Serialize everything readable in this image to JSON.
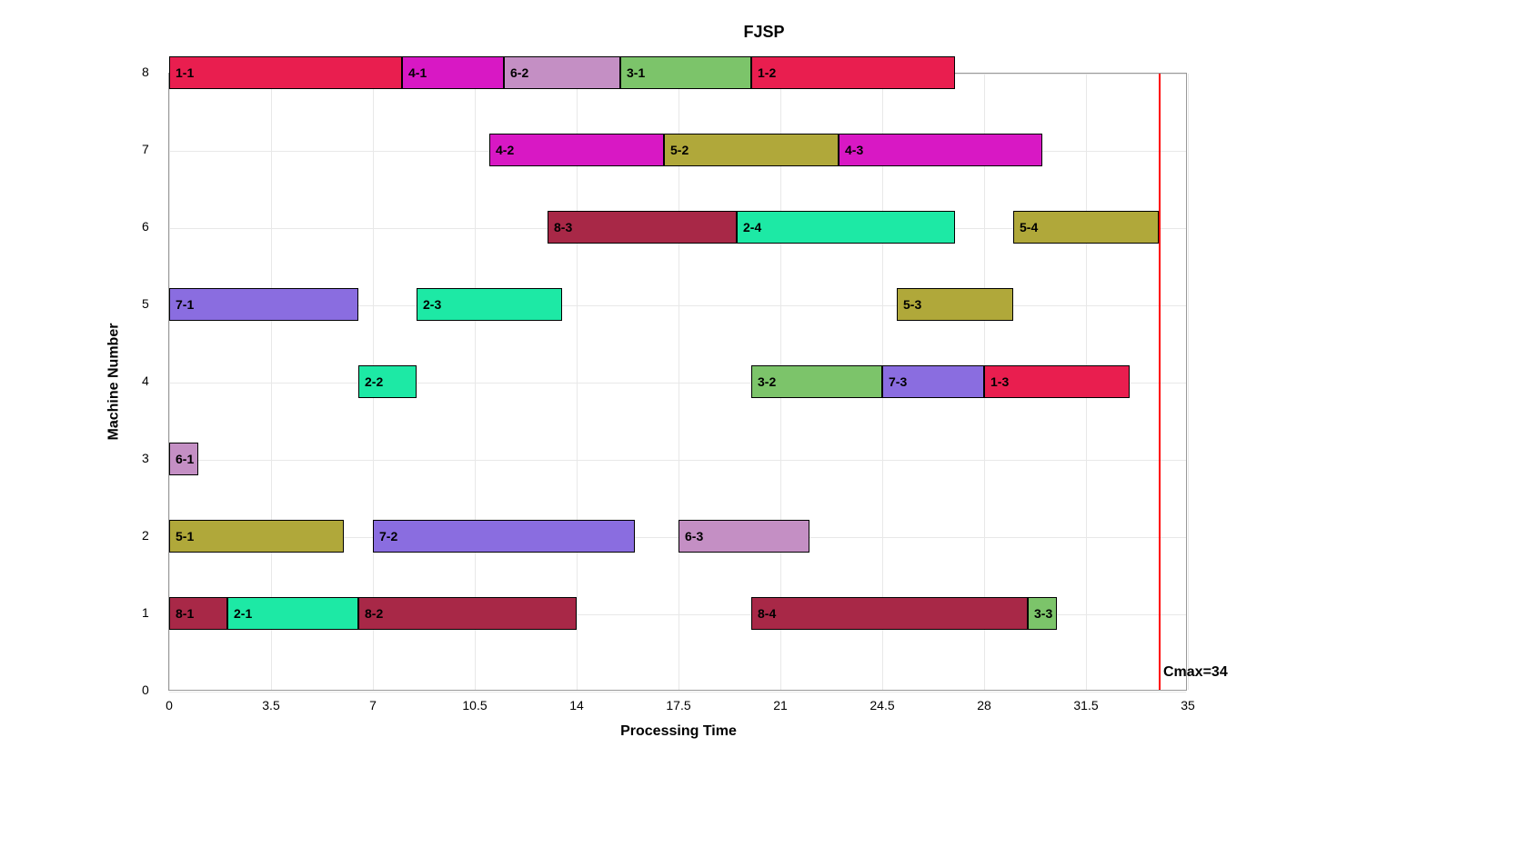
{
  "chart_data": {
    "type": "bar",
    "title": "FJSP",
    "xlabel": "Processing Time",
    "ylabel": "Machine Number",
    "xlim": [
      0,
      35
    ],
    "ylim": [
      0,
      8
    ],
    "xticks": [
      0,
      3.5,
      7,
      10.5,
      14,
      17.5,
      21,
      24.5,
      28,
      31.5,
      35
    ],
    "yticks": [
      0,
      1,
      2,
      3,
      4,
      5,
      6,
      7,
      8
    ],
    "cmax": 34,
    "cmax_label": "Cmax=34",
    "job_colors": {
      "1": "#e91e4f",
      "2": "#1de9a5",
      "3": "#7cc46a",
      "4": "#d818c4",
      "5": "#b0a83a",
      "6": "#c48fc4",
      "7": "#8a6de0",
      "8": "#a82847"
    },
    "bars": [
      {
        "machine": 8,
        "start": 0,
        "end": 8,
        "label": "1-1",
        "job": 1
      },
      {
        "machine": 8,
        "start": 8,
        "end": 11.5,
        "label": "4-1",
        "job": 4
      },
      {
        "machine": 8,
        "start": 11.5,
        "end": 15.5,
        "label": "6-2",
        "job": 6
      },
      {
        "machine": 8,
        "start": 15.5,
        "end": 20,
        "label": "3-1",
        "job": 3
      },
      {
        "machine": 8,
        "start": 20,
        "end": 27,
        "label": "1-2",
        "job": 1
      },
      {
        "machine": 7,
        "start": 11,
        "end": 17,
        "label": "4-2",
        "job": 4
      },
      {
        "machine": 7,
        "start": 17,
        "end": 23,
        "label": "5-2",
        "job": 5
      },
      {
        "machine": 7,
        "start": 23,
        "end": 30,
        "label": "4-3",
        "job": 4
      },
      {
        "machine": 6,
        "start": 13,
        "end": 19.5,
        "label": "8-3",
        "job": 8
      },
      {
        "machine": 6,
        "start": 19.5,
        "end": 27,
        "label": "2-4",
        "job": 2
      },
      {
        "machine": 6,
        "start": 29,
        "end": 34,
        "label": "5-4",
        "job": 5
      },
      {
        "machine": 5,
        "start": 0,
        "end": 6.5,
        "label": "7-1",
        "job": 7
      },
      {
        "machine": 5,
        "start": 8.5,
        "end": 13.5,
        "label": "2-3",
        "job": 2
      },
      {
        "machine": 5,
        "start": 25,
        "end": 29,
        "label": "5-3",
        "job": 5
      },
      {
        "machine": 4,
        "start": 6.5,
        "end": 8.5,
        "label": "2-2",
        "job": 2
      },
      {
        "machine": 4,
        "start": 20,
        "end": 24.5,
        "label": "3-2",
        "job": 3
      },
      {
        "machine": 4,
        "start": 24.5,
        "end": 28,
        "label": "7-3",
        "job": 7
      },
      {
        "machine": 4,
        "start": 28,
        "end": 33,
        "label": "1-3",
        "job": 1
      },
      {
        "machine": 3,
        "start": 0,
        "end": 1,
        "label": "6-1",
        "job": 6
      },
      {
        "machine": 2,
        "start": 0,
        "end": 6,
        "label": "5-1",
        "job": 5
      },
      {
        "machine": 2,
        "start": 7,
        "end": 16,
        "label": "7-2",
        "job": 7
      },
      {
        "machine": 2,
        "start": 17.5,
        "end": 22,
        "label": "6-3",
        "job": 6
      },
      {
        "machine": 1,
        "start": 0,
        "end": 2,
        "label": "8-1",
        "job": 8
      },
      {
        "machine": 1,
        "start": 2,
        "end": 6.5,
        "label": "2-1",
        "job": 2
      },
      {
        "machine": 1,
        "start": 6.5,
        "end": 14,
        "label": "8-2",
        "job": 8
      },
      {
        "machine": 1,
        "start": 20,
        "end": 29.5,
        "label": "8-4",
        "job": 8
      },
      {
        "machine": 1,
        "start": 29.5,
        "end": 30.5,
        "label": "3-3",
        "job": 3
      }
    ]
  }
}
